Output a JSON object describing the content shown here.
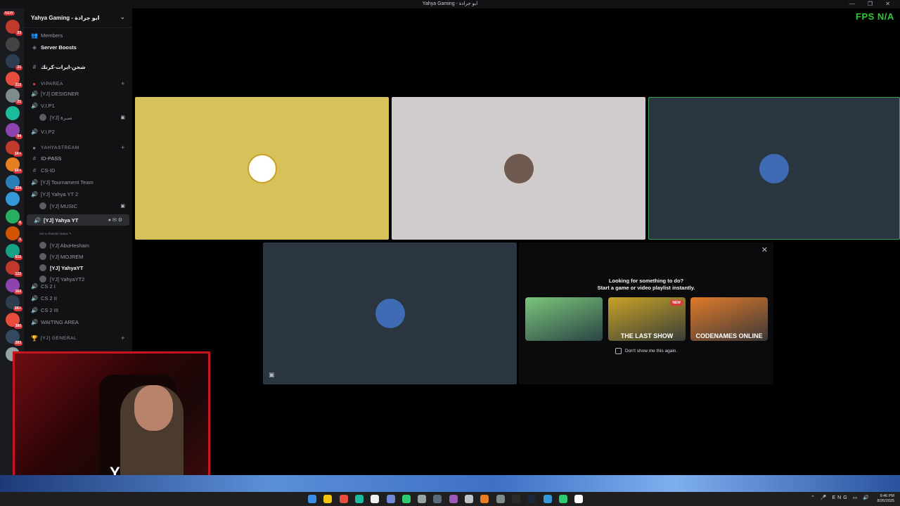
{
  "window": {
    "title": "Yahya Gaming - ابو جرادة",
    "controls": "— ❐ ✕"
  },
  "overlay": {
    "fps_label": "FPS",
    "fps_value": "N/A"
  },
  "server": {
    "name": "Yahya Gaming - ابو جرادة",
    "chevron": "⌄"
  },
  "server_rail": {
    "new_label": "NEW",
    "badges": [
      "23",
      "",
      "21",
      "212",
      "21",
      "",
      "94",
      "1K+",
      "6K+",
      "324",
      "",
      "6",
      "1",
      "615",
      "122",
      "162",
      "1K+",
      "380",
      "283",
      ""
    ]
  },
  "sidebar": {
    "members": "Members",
    "server_boosts": "Server Boosts",
    "channel_arabic": "شحن-ايرات-كرنك",
    "cat_vip": "VIPAREA",
    "designer": "[YJ] DESIGNER",
    "vip1": "V.I.P1",
    "vip1_user": "[YJ] سـرة",
    "vip2": "V.I.P2",
    "cat_stream": "YAHYASTREAM",
    "id_pass": "ID-PASS",
    "cs_id": "CS-ID",
    "tournament": "[YJ] Tournament Team",
    "yahya_yt2": "[YJ] Yahya YT 2",
    "music": "[YJ] MUSIC",
    "yahya_yt": "[YJ] Yahya YT",
    "status_hint": "Set a channel status ✎",
    "voice_users": [
      "[YJ] AbuHesham",
      "[YJ] MOJREM",
      "[YJ] YahyaYT",
      "[YJ] YahyaYT2"
    ],
    "cs2_1": "CS 2 I",
    "cs2_2": "CS 2 II",
    "cs2_3": "CS 2 III",
    "waiting": "WAITING AREA",
    "cat_general": "[YJ] GENERAL"
  },
  "activity": {
    "line1": "Looking for something to do?",
    "line2": "Start a game or video playlist instantly.",
    "games": [
      {
        "name": "",
        "color": "#7bc67b"
      },
      {
        "name": "THE LAST SHOW",
        "color": "#c9a227",
        "badge": "NEW"
      },
      {
        "name": "CODENAMES ONLINE",
        "color": "#e07b2a"
      }
    ],
    "checkbox_label": "Don't show me this again."
  },
  "colors": {
    "tile_yellow": "#d6c15a",
    "tile_gray": "#cfcccb",
    "tile_dark": "#2b353f",
    "speaking_border": "#3ba55d",
    "accent_red": "#c8141e"
  },
  "cam": {
    "logo": "Y"
  },
  "taskbar": {
    "lang": "ENG",
    "time": "9:46 PM",
    "date": "8/26/2025"
  }
}
